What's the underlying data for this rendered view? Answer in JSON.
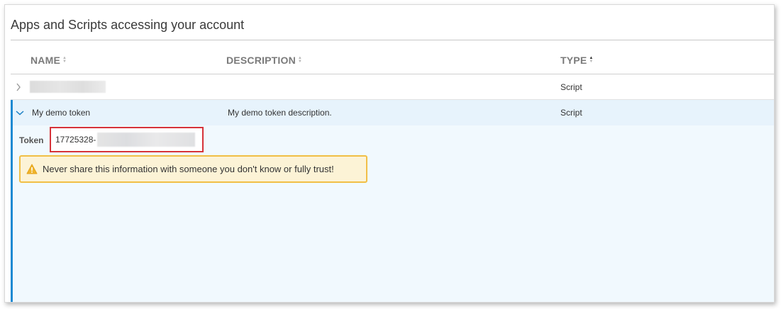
{
  "panel": {
    "title": "Apps and Scripts accessing your account"
  },
  "table": {
    "columns": [
      {
        "label": "NAME",
        "sort": "none"
      },
      {
        "label": "DESCRIPTION",
        "sort": "none"
      },
      {
        "label": "TYPE",
        "sort": "ascending"
      }
    ],
    "rows": [
      {
        "name": "",
        "name_redacted": true,
        "description": "",
        "type": "Script",
        "expanded": false
      },
      {
        "name": "My demo token",
        "description": "My demo token description.",
        "type": "Script",
        "expanded": true
      }
    ]
  },
  "detail": {
    "token_label": "Token",
    "token_value_visible": "17725328-",
    "token_redacted": true,
    "warning_icon": "warning-triangle-icon",
    "warning_text": "Never share this information with someone you don't know or fully trust!"
  },
  "colors": {
    "accent": "#1f8ad2",
    "selected_row_bg": "#e7f3fc",
    "highlight_border": "#d6333a",
    "warning_bg": "#fcf3d6",
    "warning_border": "#f1bf46"
  }
}
